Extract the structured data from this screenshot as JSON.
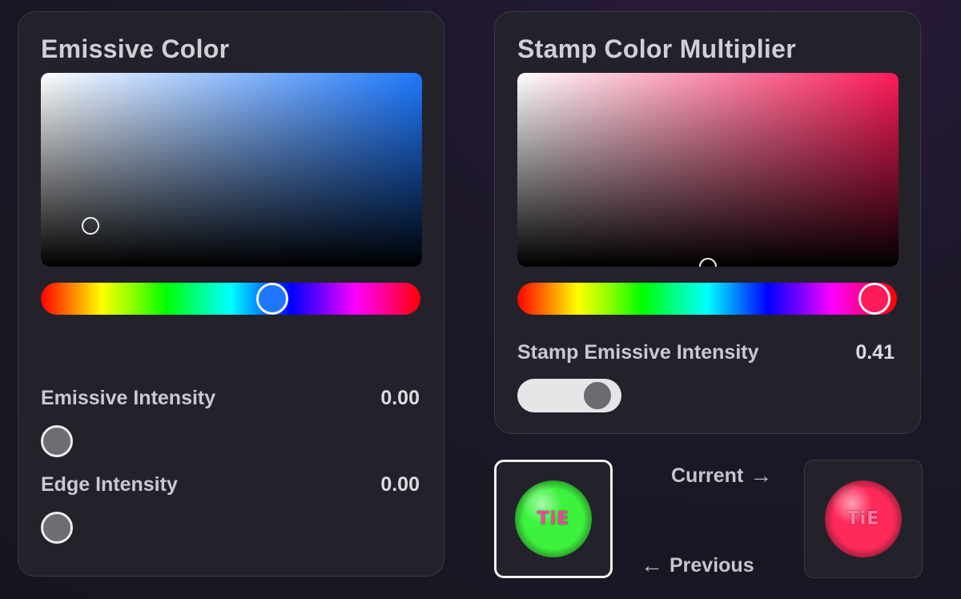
{
  "emissive": {
    "title": "Emissive Color",
    "hue_color": "#1e78ff",
    "hue_position": 0.61,
    "cursor": {
      "saturation": 0.13,
      "value": 0.21
    },
    "intensity": {
      "label": "Emissive Intensity",
      "value": "0.00",
      "level": 0.0
    },
    "edge": {
      "label": "Edge Intensity",
      "value": "0.00",
      "level": 0.0
    }
  },
  "stamp": {
    "title": "Stamp Color Multiplier",
    "hue_color": "#ff1a5a",
    "hue_position": 0.94,
    "cursor": {
      "saturation": 0.5,
      "value": 0.0
    },
    "intensity": {
      "label": "Stamp Emissive Intensity",
      "value": "0.41",
      "level": 0.41
    }
  },
  "preview": {
    "current_label": "Current",
    "previous_label": "Previous",
    "previous_colors": {
      "base": "#3cf23c",
      "accent": "#ff3fa0"
    },
    "current_colors": {
      "base": "#ff2a5a",
      "accent": "#ff7aa8"
    },
    "ball_text": "TiE"
  },
  "icons": {
    "right_arrow": "→",
    "left_arrow": "←"
  }
}
